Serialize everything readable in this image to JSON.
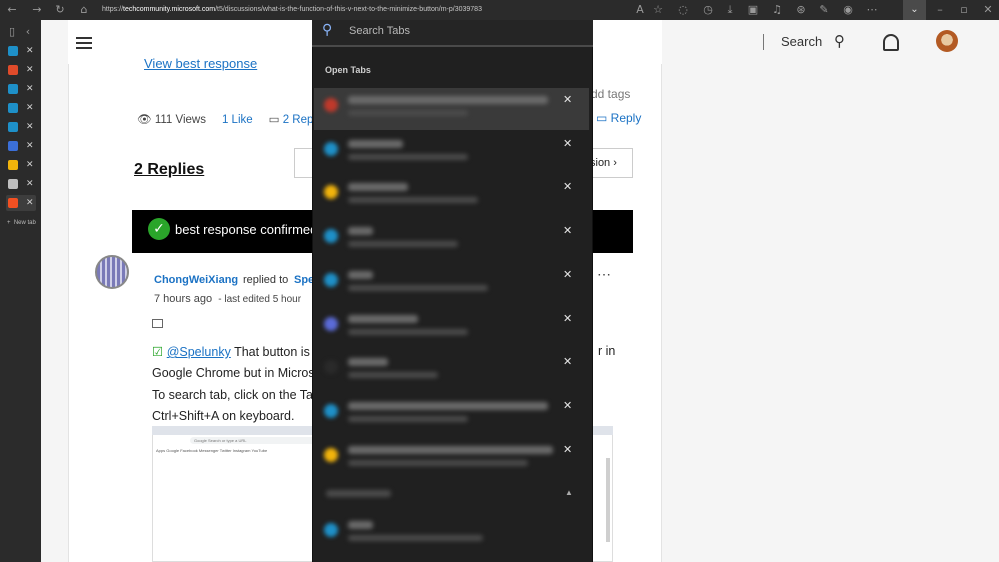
{
  "browser": {
    "url_prefix": "https://",
    "url_host": "techcommunity.microsoft.com",
    "url_path": "/t5/discussions/what-is-the-function-of-this-v-next-to-the-minimize-button/m-p/3039783",
    "new_tab_label": "New tab"
  },
  "vertical_tabs": [
    {
      "color": "#1e90c8"
    },
    {
      "color": "#e04b2a"
    },
    {
      "color": "#1e90c8"
    },
    {
      "color": "#1e90c8"
    },
    {
      "color": "#1e90c8"
    },
    {
      "color": "#3b6fd8"
    },
    {
      "color": "#f2b40c"
    },
    {
      "color": "#bfbfbf"
    },
    {
      "color": "#f25022"
    }
  ],
  "header": {
    "search_label": "Search"
  },
  "post": {
    "view_best_response": "View best response",
    "views": "111 Views",
    "likes": "1 Like",
    "replies_link": "2 Replies",
    "add_tags": "dd tags",
    "reply_label": "Reply",
    "replies_title": "2 Replies",
    "next_discussion": "sion",
    "best_response": "best response confirmed"
  },
  "reply": {
    "author": "ChongWeiXiang",
    "replied_to_text": "replied to",
    "replied_to_user": "Spe",
    "time": "7 hours ago",
    "last_edited": "- last edited 5 hour",
    "mention": "@Spelunky",
    "line1": " That button is ",
    "line1_end": "r in",
    "line2": "Google Chrome but in Micros",
    "line3": "To search tab, click on the Tab",
    "line4": "Ctrl+Shift+A on keyboard.",
    "shot_address": "Google Search or type a URL",
    "shot_bookmarks": "Apps  Google  Facebook  Messenger  Twitter  Instagram  YouTube"
  },
  "search_tabs": {
    "placeholder": "Search Tabs",
    "open_tabs_label": "Open Tabs",
    "close_glyph": "✕",
    "rows": [
      {
        "fav": "#c0392b",
        "w1": 200,
        "w2": 120,
        "highlight": true
      },
      {
        "fav": "#1e90c8",
        "w1": 55,
        "w2": 120
      },
      {
        "fav": "#f2b40c",
        "w1": 60,
        "w2": 130
      },
      {
        "fav": "#1e90c8",
        "w1": 25,
        "w2": 110
      },
      {
        "fav": "#1e90c8",
        "w1": 25,
        "w2": 140
      },
      {
        "fav": "#5b6bd8",
        "w1": 70,
        "w2": 120
      },
      {
        "fav": "#2a2a2a",
        "w1": 40,
        "w2": 90
      },
      {
        "fav": "#1e90c8",
        "w1": 200,
        "w2": 120
      },
      {
        "fav": "#f2b40c",
        "w1": 205,
        "w2": 180
      }
    ],
    "recent": {
      "fav": "#1e90c8",
      "w1": 25,
      "w2": 135
    }
  }
}
